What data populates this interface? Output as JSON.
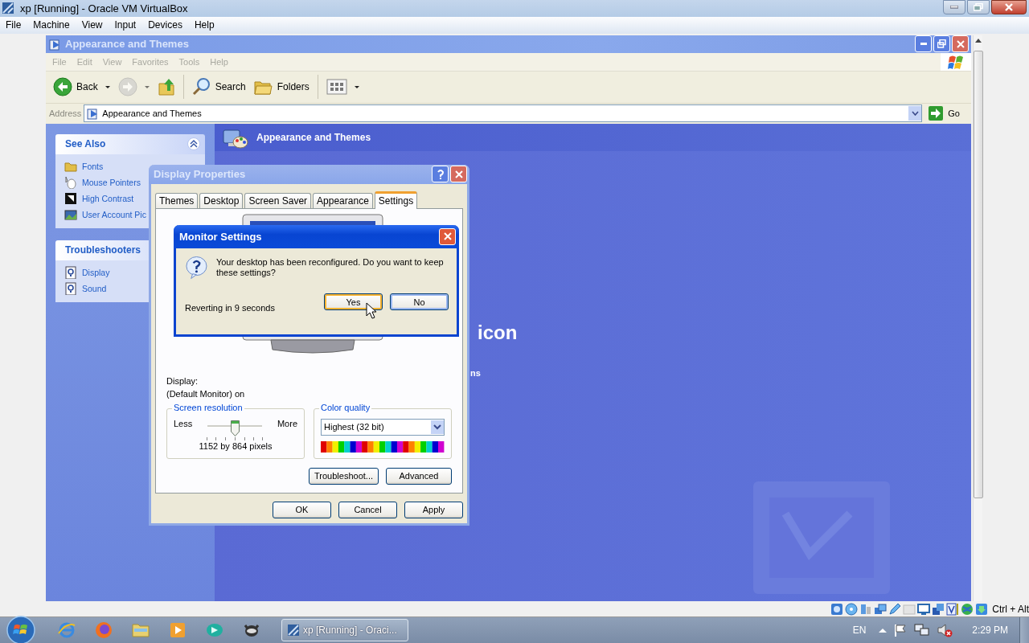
{
  "host_window": {
    "title": "xp [Running] - Oracle VM VirtualBox",
    "menu": [
      "File",
      "Machine",
      "View",
      "Input",
      "Devices",
      "Help"
    ],
    "host_key": "Ctrl + Alt"
  },
  "explorer": {
    "title": "Appearance and Themes",
    "menu": [
      "File",
      "Edit",
      "View",
      "Favorites",
      "Tools",
      "Help"
    ],
    "toolbar": [
      {
        "kind": "back",
        "label": "Back",
        "disabled": false
      },
      {
        "kind": "forward",
        "disabled": true
      },
      {
        "kind": "up"
      },
      {
        "kind": "search",
        "label": "Search"
      },
      {
        "kind": "folders",
        "label": "Folders"
      },
      {
        "kind": "views"
      }
    ],
    "address": {
      "label": "Address",
      "value": "Appearance and Themes"
    },
    "go": "Go",
    "sidebar": [
      {
        "title": "See Also",
        "items": [
          {
            "kind": "fonts",
            "label": "Fonts"
          },
          {
            "kind": "pointer",
            "label": "Mouse Pointers"
          },
          {
            "kind": "contrast",
            "label": "High Contrast"
          },
          {
            "kind": "picture",
            "label": "User Account Pic"
          }
        ]
      },
      {
        "title": "Troubleshooters",
        "items": [
          {
            "kind": "help",
            "label": "Display"
          },
          {
            "kind": "help",
            "label": "Sound"
          }
        ]
      }
    ],
    "header": "Appearance and Themes",
    "fragments": [
      "icon",
      "ns"
    ]
  },
  "display_properties": {
    "title": "Display Properties",
    "tabs": [
      {
        "label": "Themes",
        "selected": false
      },
      {
        "label": "Desktop",
        "selected": false
      },
      {
        "label": "Screen Saver",
        "selected": false
      },
      {
        "label": "Appearance",
        "selected": false
      },
      {
        "label": "Settings",
        "selected": true
      }
    ],
    "display_label": "Display:",
    "display_value": "(Default Monitor) on",
    "resolution": {
      "title": "Screen resolution",
      "less": "Less",
      "more": "More",
      "level": 0.5,
      "reading": "1152 by 864 pixels"
    },
    "color_quality": {
      "title": "Color quality",
      "value": "Highest (32 bit)"
    },
    "panel_buttons": [
      "Troubleshoot...",
      "Advanced"
    ],
    "buttons": [
      "OK",
      "Cancel",
      "Apply"
    ]
  },
  "monitor_settings": {
    "title": "Monitor Settings",
    "message": "Your desktop has been reconfigured.  Do you want to keep these settings?",
    "countdown": "Reverting in 9 seconds",
    "buttons": [
      {
        "label": "Yes",
        "hovered": true,
        "default": false
      },
      {
        "label": "No",
        "hovered": false,
        "default": true
      }
    ]
  },
  "taskbar": {
    "tasks": [
      {
        "label": "xp [Running] - Oraci...",
        "selected": true
      }
    ],
    "language": "EN",
    "clock": "2:29 PM"
  }
}
